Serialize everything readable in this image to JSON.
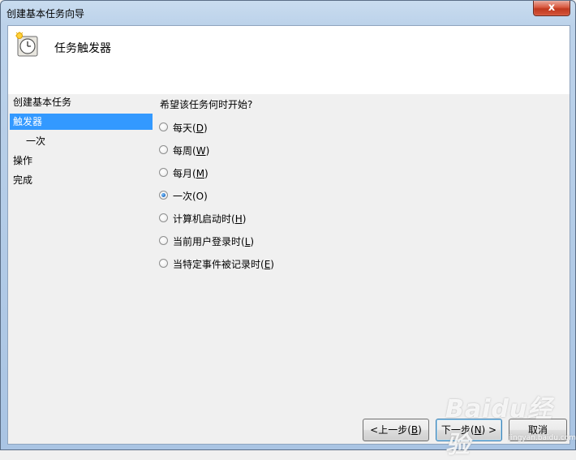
{
  "window": {
    "title": "创建基本任务向导",
    "close_label": "x"
  },
  "header": {
    "title": "任务触发器",
    "icon": "clock-icon"
  },
  "steps": [
    {
      "label": "创建基本任务",
      "selected": false
    },
    {
      "label": "触发器",
      "selected": true
    },
    {
      "label": "一次",
      "selected": false
    },
    {
      "label": "操作",
      "selected": false
    },
    {
      "label": "完成",
      "selected": false
    }
  ],
  "content": {
    "question": "希望该任务何时开始?",
    "options": [
      {
        "label": "每天(",
        "key": "D",
        "close": ")",
        "checked": false
      },
      {
        "label": "每周(",
        "key": "W",
        "close": ")",
        "checked": false
      },
      {
        "label": "每月(",
        "key": "M",
        "close": ")",
        "checked": false
      },
      {
        "label": "一次(O)",
        "key": "",
        "close": "",
        "checked": true
      },
      {
        "label": "计算机启动时(",
        "key": "H",
        "close": ")",
        "checked": false
      },
      {
        "label": "当前用户登录时(",
        "key": "L",
        "close": ")",
        "checked": false
      },
      {
        "label": "当特定事件被记录时(",
        "key": "E",
        "close": ")",
        "checked": false
      }
    ]
  },
  "buttons": {
    "back": {
      "prefix": "<上一步(",
      "key": "B",
      "suffix": ")"
    },
    "next": {
      "prefix": "下一步(",
      "key": "N",
      "suffix": ") >"
    },
    "cancel": {
      "label": "取消"
    }
  },
  "watermark": {
    "brand": "Baidu经验",
    "sub": "jingyan.baidu.com"
  }
}
